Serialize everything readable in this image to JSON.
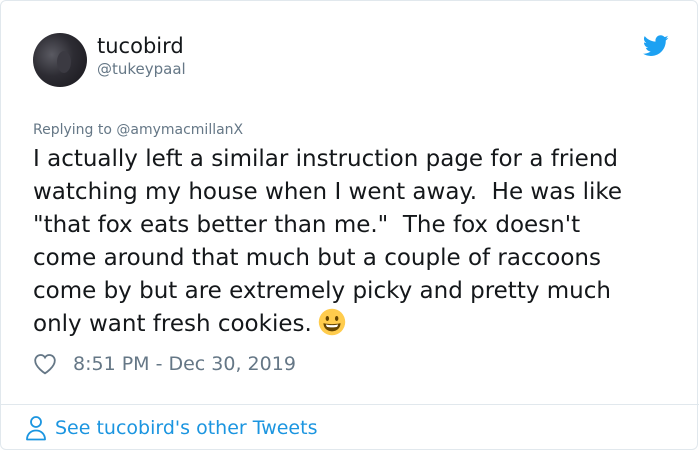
{
  "user": {
    "display_name": "tucobird",
    "handle": "@tukeypaal"
  },
  "tweet": {
    "replying_to": "Replying to @amymacmillanX",
    "text": "I actually left a similar instruction page for a friend\nwatching my house when I went away.  He was like\n\"that fox eats better than me.\"  The fox doesn't\ncome around that much but a couple of raccoons\ncome by but are extremely picky and pretty much\nonly want fresh cookies.",
    "emoji": "grinning-face-emoji",
    "timestamp": "8:51 PM - Dec 30, 2019"
  },
  "footer": {
    "link_label": "See tucobird's other Tweets"
  },
  "icons": {
    "brand": "twitter-bird-icon",
    "like": "heart-icon",
    "profile": "person-icon"
  },
  "colors": {
    "twitter_blue": "#1da1f2",
    "link_blue": "#1b95e0",
    "secondary_text": "#657786",
    "primary_text": "#14171a",
    "border": "#e1e8ed"
  }
}
